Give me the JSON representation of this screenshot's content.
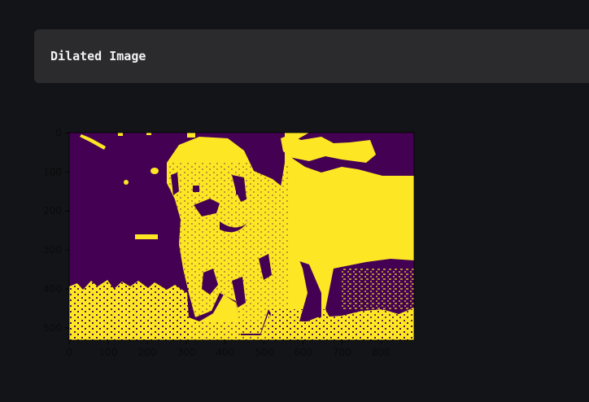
{
  "header": {
    "title": "Dilated Image"
  },
  "image_plot": {
    "colormap": {
      "background": "#440154",
      "foreground": "#fde725"
    },
    "x_ticks": [
      "0",
      "100",
      "200",
      "300",
      "400",
      "500",
      "600",
      "700",
      "800"
    ],
    "y_ticks": [
      "0",
      "100",
      "200",
      "300",
      "400",
      "500"
    ],
    "x_tick_values": [
      0,
      100,
      200,
      300,
      400,
      500,
      600,
      700,
      800
    ],
    "y_tick_values": [
      0,
      100,
      200,
      300,
      400,
      500
    ],
    "x_range": [
      0,
      888
    ],
    "y_range": [
      0,
      534
    ],
    "content": "binary dilated mask of a dog sitting in grass"
  }
}
